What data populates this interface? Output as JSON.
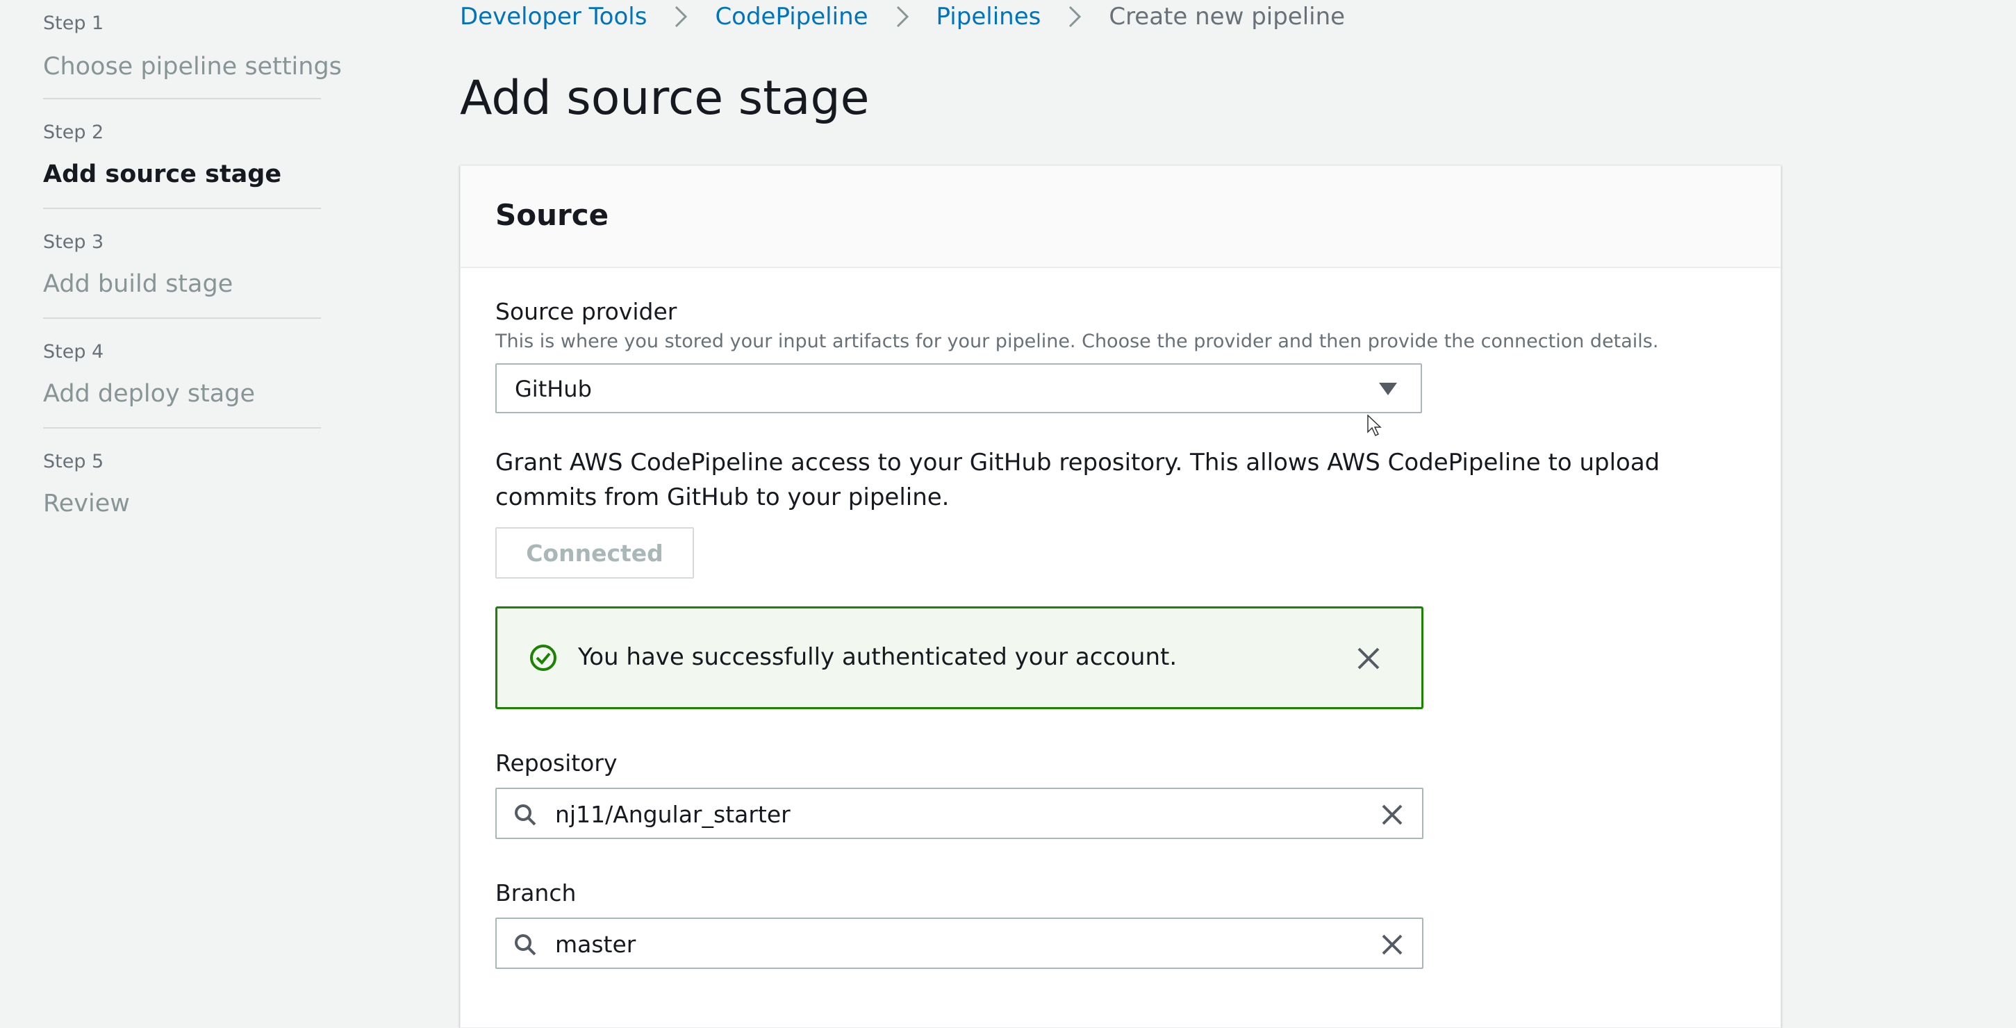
{
  "steps": [
    {
      "num": "Step 1",
      "title": "Choose pipeline settings"
    },
    {
      "num": "Step 2",
      "title": "Add source stage"
    },
    {
      "num": "Step 3",
      "title": "Add build stage"
    },
    {
      "num": "Step 4",
      "title": "Add deploy stage"
    },
    {
      "num": "Step 5",
      "title": "Review"
    }
  ],
  "active_step": 2,
  "breadcrumb": {
    "items": [
      "Developer Tools",
      "CodePipeline",
      "Pipelines"
    ],
    "current": "Create new pipeline"
  },
  "page_title": "Add source stage",
  "panel": {
    "title": "Source",
    "source_provider": {
      "label": "Source provider",
      "description": "This is where you stored your input artifacts for your pipeline. Choose the provider and then provide the connection details.",
      "value": "GitHub"
    },
    "grant_text": "Grant AWS CodePipeline access to your GitHub repository. This allows AWS CodePipeline to upload commits from GitHub to your pipeline.",
    "connected_label": "Connected",
    "alert_text": "You have successfully authenticated your account.",
    "repository": {
      "label": "Repository",
      "value": "nj11/Angular_starter"
    },
    "branch": {
      "label": "Branch",
      "value": "master"
    }
  },
  "colors": {
    "link": "#0073bb",
    "success": "#1d8102",
    "muted": "#879596",
    "background": "#f2f3f3"
  },
  "icons": [
    "chevron-right-icon",
    "caret-down-icon",
    "check-circle-icon",
    "close-icon",
    "search-icon",
    "clear-icon",
    "mouse-cursor-icon"
  ]
}
